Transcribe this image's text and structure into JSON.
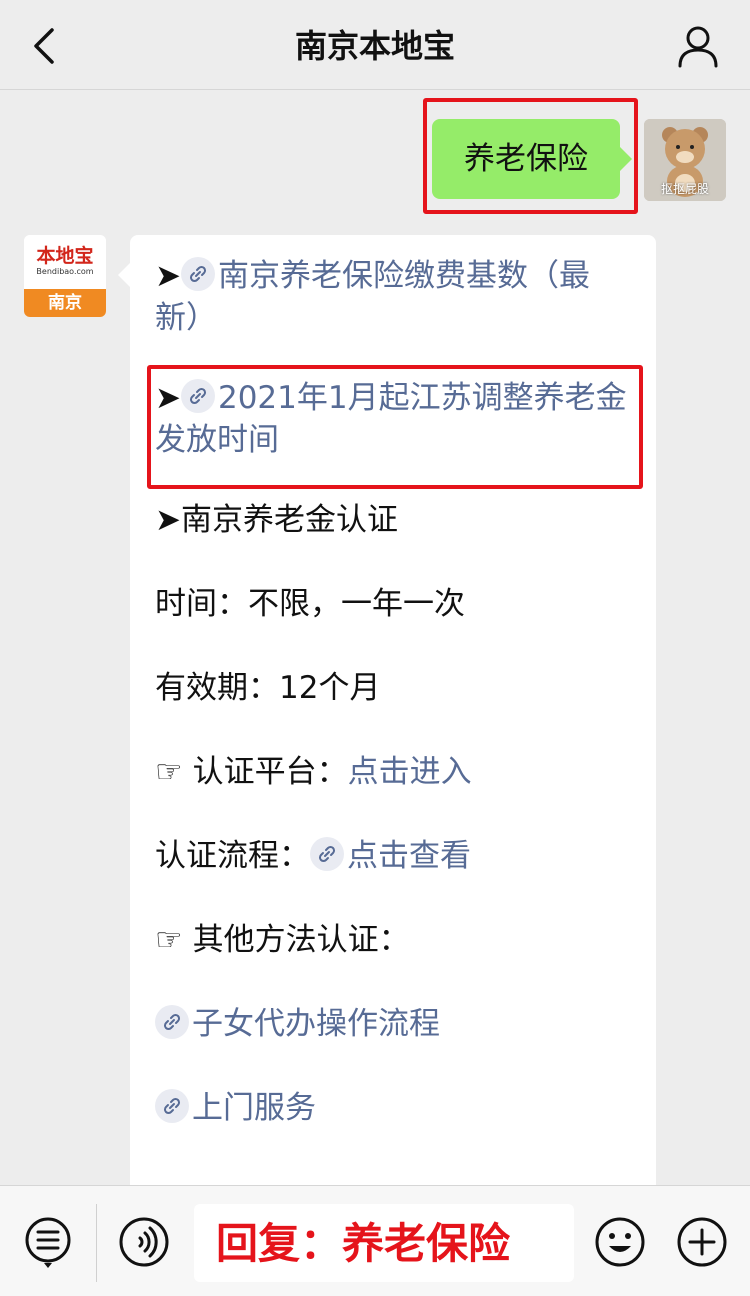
{
  "header": {
    "title": "南京本地宝"
  },
  "outgoing": {
    "text": "养老保险",
    "avatar_caption": "抠抠屁股"
  },
  "incoming": {
    "avatar_brand": "本地宝",
    "avatar_brand_sub": "Bendibao.com",
    "avatar_city": "南京",
    "lines": [
      {
        "prefix": "➤",
        "text": "南京养老保险缴费基数（最新）",
        "link": true
      },
      {
        "prefix": "➤",
        "text": "2021年1月起江苏调整养老金发放时间",
        "link": true
      },
      {
        "prefix": "➤",
        "text": "南京养老金认证"
      },
      {
        "text": "时间：不限，一年一次"
      },
      {
        "text": "有效期：12个月"
      },
      {
        "prefix": "☞ ",
        "label": "认证平台：",
        "link_text": "点击进入"
      },
      {
        "label": "认证流程：",
        "link_text": "点击查看"
      },
      {
        "prefix": "☞ ",
        "text": "其他方法认证："
      },
      {
        "link_text": "子女代办操作流程"
      },
      {
        "link_text": "上门服务"
      }
    ]
  },
  "input": {
    "text": "回复：养老保险"
  },
  "colors": {
    "accent_red": "#e5141b",
    "bubble_green": "#95ec69",
    "link_blue": "#576b95"
  },
  "icons": [
    "back-icon",
    "profile-icon",
    "menu-list-icon",
    "voice-icon",
    "emoji-icon",
    "plus-icon",
    "link-chain-icon"
  ]
}
